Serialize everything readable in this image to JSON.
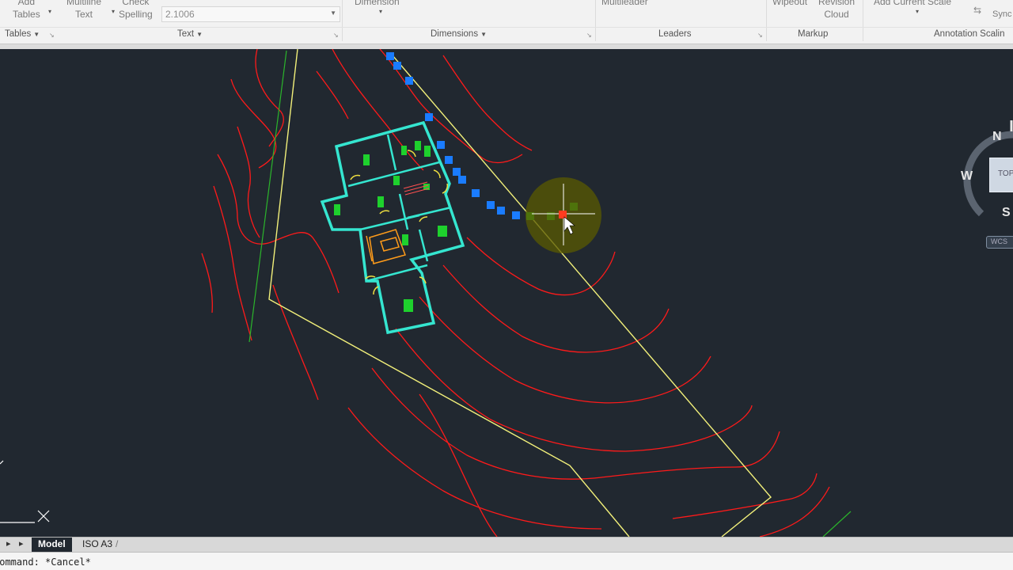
{
  "ribbon": {
    "tables": {
      "line1": "Add",
      "line2": "Tables"
    },
    "multiline_text": {
      "line1": "Multiline",
      "line2": "Text"
    },
    "check_spelling": {
      "line1": "Check",
      "line2": "Spelling"
    },
    "text_height_value": "2.1006",
    "dimension_label": "Dimension",
    "multileader_label": "Multileader",
    "wipeout_label": "Wipeout",
    "revision_cloud": {
      "line1": "Revision",
      "line2": "Cloud"
    },
    "add_current_scale_label": "Add Current Scale",
    "sync_label": "Sync",
    "panels": {
      "tables": "Tables",
      "text": "Text",
      "dimensions": "Dimensions",
      "leaders": "Leaders",
      "markup": "Markup",
      "annotation_scaling": "Annotation Scalin"
    }
  },
  "viewcube": {
    "north": "N",
    "west": "W",
    "south": "S",
    "top_face": "TOP",
    "wcs": "WCS"
  },
  "tabs": {
    "model": "Model",
    "layout1": "ISO A3"
  },
  "command_line": "Command: *Cancel*",
  "colors": {
    "canvas_bg": "#212830",
    "contour": "#ff1a1a",
    "boundary": "#f2f07a",
    "building": "#35e6d0",
    "fixtures": "#1ed12d",
    "grips": "#1a7cff",
    "doors": "#f0e040"
  }
}
